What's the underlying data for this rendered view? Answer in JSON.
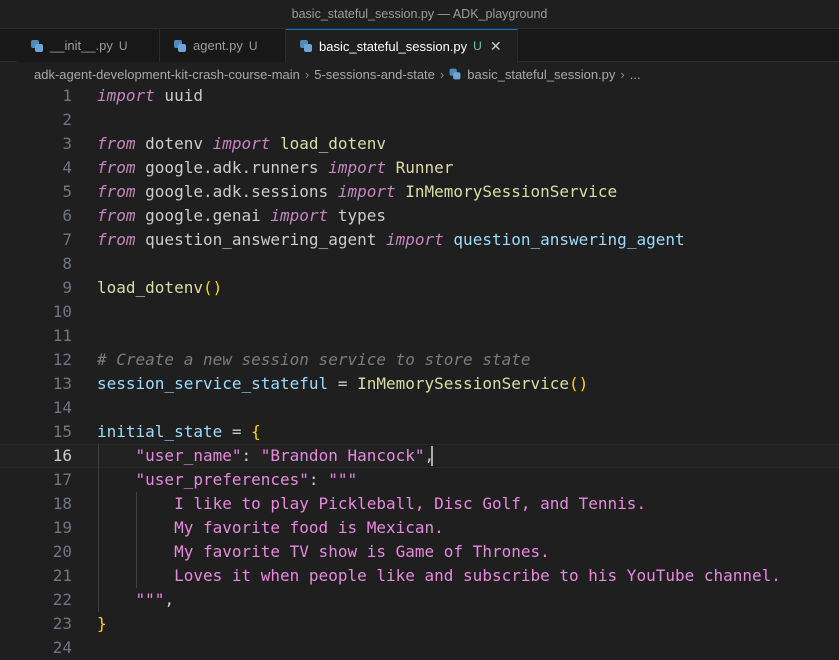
{
  "window": {
    "title": "basic_stateful_session.py — ADK_playground"
  },
  "tabs": [
    {
      "label": "__init__.py",
      "status": "U",
      "active": false
    },
    {
      "label": "agent.py",
      "status": "U",
      "active": false
    },
    {
      "label": "basic_stateful_session.py",
      "status": "U",
      "active": true,
      "close": "✕"
    }
  ],
  "breadcrumb": {
    "items": [
      "adk-agent-development-kit-crash-course-main",
      "5-sessions-and-state",
      "basic_stateful_session.py",
      "..."
    ],
    "separator": "›"
  },
  "editor": {
    "current_line": 16,
    "lines": [
      {
        "n": "1",
        "tokens": [
          [
            "kw",
            "import"
          ],
          [
            "plain",
            " uuid"
          ]
        ]
      },
      {
        "n": "2",
        "tokens": []
      },
      {
        "n": "3",
        "tokens": [
          [
            "kw",
            "from"
          ],
          [
            "plain",
            " dotenv "
          ],
          [
            "kw",
            "import"
          ],
          [
            "plain",
            " "
          ],
          [
            "fn",
            "load_dotenv"
          ]
        ]
      },
      {
        "n": "4",
        "tokens": [
          [
            "kw",
            "from"
          ],
          [
            "plain",
            " google.adk.runners "
          ],
          [
            "kw",
            "import"
          ],
          [
            "plain",
            " "
          ],
          [
            "cls2",
            "Runner"
          ]
        ]
      },
      {
        "n": "5",
        "tokens": [
          [
            "kw",
            "from"
          ],
          [
            "plain",
            " google.adk.sessions "
          ],
          [
            "kw",
            "import"
          ],
          [
            "plain",
            " "
          ],
          [
            "cls2",
            "InMemorySessionService"
          ]
        ]
      },
      {
        "n": "6",
        "tokens": [
          [
            "kw",
            "from"
          ],
          [
            "plain",
            " google.genai "
          ],
          [
            "kw",
            "import"
          ],
          [
            "plain",
            " types"
          ]
        ]
      },
      {
        "n": "7",
        "tokens": [
          [
            "kw",
            "from"
          ],
          [
            "plain",
            " question_answering_agent "
          ],
          [
            "kw",
            "import"
          ],
          [
            "plain",
            " "
          ],
          [
            "var",
            "question_answering_agent"
          ]
        ]
      },
      {
        "n": "8",
        "tokens": []
      },
      {
        "n": "9",
        "tokens": [
          [
            "fn",
            "load_dotenv"
          ],
          [
            "br1",
            "()"
          ]
        ]
      },
      {
        "n": "10",
        "tokens": []
      },
      {
        "n": "11",
        "tokens": []
      },
      {
        "n": "12",
        "tokens": [
          [
            "com",
            "# Create a new session service to store state"
          ]
        ]
      },
      {
        "n": "13",
        "tokens": [
          [
            "var",
            "session_service_stateful"
          ],
          [
            "plain",
            " = "
          ],
          [
            "cls2",
            "InMemorySessionService"
          ],
          [
            "br1",
            "()"
          ]
        ]
      },
      {
        "n": "14",
        "tokens": []
      },
      {
        "n": "15",
        "tokens": [
          [
            "var",
            "initial_state"
          ],
          [
            "plain",
            " = "
          ],
          [
            "br1",
            "{"
          ]
        ]
      },
      {
        "n": "16",
        "tokens": [
          [
            "plain",
            "    "
          ],
          [
            "str",
            "\"user_name\""
          ],
          [
            "plain",
            ": "
          ],
          [
            "str",
            "\"Brandon Hancock\""
          ],
          [
            "plain",
            ","
          ]
        ]
      },
      {
        "n": "17",
        "tokens": [
          [
            "plain",
            "    "
          ],
          [
            "str",
            "\"user_preferences\""
          ],
          [
            "plain",
            ": "
          ],
          [
            "str",
            "\"\"\""
          ]
        ]
      },
      {
        "n": "18",
        "tokens": [
          [
            "str",
            "        I like to play Pickleball, Disc Golf, and Tennis."
          ]
        ]
      },
      {
        "n": "19",
        "tokens": [
          [
            "str",
            "        My favorite food is Mexican."
          ]
        ]
      },
      {
        "n": "20",
        "tokens": [
          [
            "str",
            "        My favorite TV show is Game of Thrones."
          ]
        ]
      },
      {
        "n": "21",
        "tokens": [
          [
            "str",
            "        Loves it when people like and subscribe to his YouTube channel."
          ]
        ]
      },
      {
        "n": "22",
        "tokens": [
          [
            "str",
            "    \"\"\""
          ],
          [
            "plain",
            ","
          ]
        ]
      },
      {
        "n": "23",
        "tokens": [
          [
            "br1",
            "}"
          ]
        ]
      },
      {
        "n": "24",
        "tokens": []
      }
    ]
  },
  "colors": {
    "background": "#1f1f1f",
    "keyword": "#c586c0",
    "function": "#dcdcaa",
    "variable": "#9cdcfe",
    "string": "#e78adf",
    "comment": "#7c7c7c",
    "bracket": "#ffd700",
    "accent": "#0078d4",
    "untracked": "#73c991"
  },
  "icons": {
    "file": "python-file-icon",
    "close": "close-icon"
  }
}
